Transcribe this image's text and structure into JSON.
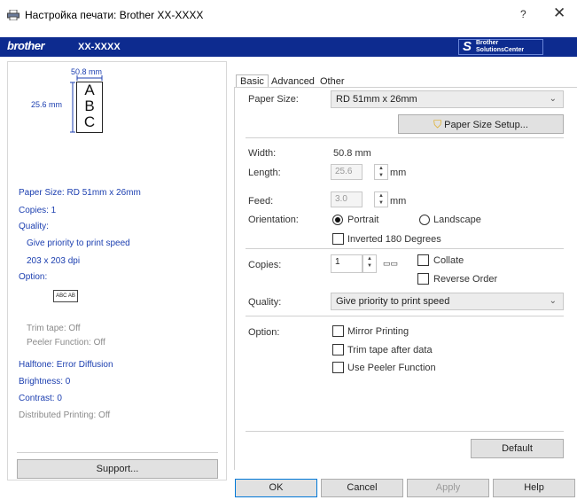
{
  "window": {
    "title": "Настройка печати: Brother XX-XXXX",
    "help": "?",
    "close": "✕"
  },
  "brand": {
    "logo": "brother",
    "model": "XX-XXXX",
    "solutions_center_line1": "Brother",
    "solutions_center_line2": "SolutionsCenter"
  },
  "preview": {
    "width_label": "50.8 mm",
    "height_label": "25.6 mm",
    "letters": [
      "A",
      "B",
      "C"
    ]
  },
  "summary": {
    "paper_size": "Paper Size: RD 51mm x 26mm",
    "copies": "Copies: 1",
    "quality": "Quality:",
    "quality_value": "Give priority to print speed",
    "dpi": "203 x 203 dpi",
    "option": "Option:",
    "option_icon_text": "ABC AB",
    "trim_tape": "Trim tape: Off",
    "peeler": "Peeler Function: Off",
    "halftone": "Halftone: Error Diffusion",
    "brightness": "Brightness:  0",
    "contrast": "Contrast:  0",
    "distributed": "Distributed Printing: Off"
  },
  "support_button": "Support...",
  "tabs": [
    "Basic",
    "Advanced",
    "Other"
  ],
  "basic": {
    "paper_size_label": "Paper Size:",
    "paper_size_value": "RD 51mm x 26mm",
    "paper_size_setup": "Paper Size Setup...",
    "width_label": "Width:",
    "width_value": "50.8 mm",
    "length_label": "Length:",
    "length_value": "25.6",
    "length_unit": "mm",
    "feed_label": "Feed:",
    "feed_value": "3.0",
    "feed_unit": "mm",
    "orientation_label": "Orientation:",
    "portrait": "Portrait",
    "landscape": "Landscape",
    "inverted": "Inverted 180 Degrees",
    "copies_label": "Copies:",
    "copies_value": "1",
    "collate": "Collate",
    "reverse_order": "Reverse Order",
    "quality_label": "Quality:",
    "quality_value": "Give priority to print speed",
    "option_label": "Option:",
    "mirror_printing": "Mirror Printing",
    "trim_tape_after": "Trim tape after data",
    "use_peeler": "Use Peeler Function",
    "default_button": "Default"
  },
  "buttons": {
    "ok": "OK",
    "cancel": "Cancel",
    "apply": "Apply",
    "help": "Help"
  },
  "colors": {
    "brand_bar": "#0d2b8f",
    "summary_text": "#1c3fb0",
    "disabled_text": "#8a8a8a",
    "ok_border": "#0078d7"
  }
}
